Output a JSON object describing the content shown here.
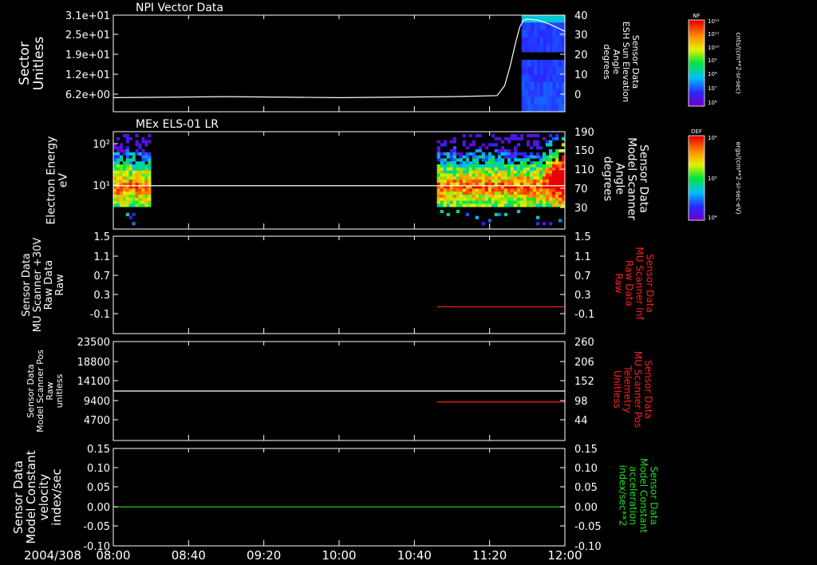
{
  "date_label": "2004/308",
  "time_ticks": [
    "08:00",
    "08:40",
    "09:20",
    "10:00",
    "10:40",
    "11:20",
    "12:00"
  ],
  "colors": {
    "background": "#000000",
    "axis": "#ffffff",
    "red": "#ff2020",
    "green": "#22dd22"
  },
  "colorbars": [
    {
      "id": "nf",
      "title": "NF",
      "ticks": [
        "10¹²",
        "10¹¹",
        "10¹⁰",
        "10⁹",
        "10⁸",
        "10⁷",
        "10⁶"
      ],
      "unit": "cnts/(cm**2-sr-sec)"
    },
    {
      "id": "def",
      "title": "DEF",
      "ticks": [
        "10⁶",
        "10⁵",
        "10⁴"
      ],
      "unit": "ergs/(cm**2-sr-sec-eV)"
    }
  ],
  "chart_data": [
    {
      "type": "heatmap",
      "title": "NPI Vector Data",
      "ylabel": [
        "Sector",
        "Unitless"
      ],
      "y_ticks": [
        "3.1e+01",
        "2.5e+01",
        "1.9e+01",
        "1.2e+01",
        "6.2e+00"
      ],
      "y2_ticks": [
        "40",
        "30",
        "20",
        "10",
        "0"
      ],
      "y2label": [
        "Sensor Data",
        "ESH Sun Elevation",
        "Angle",
        "degrees"
      ],
      "y2lim": [
        -8,
        40
      ],
      "heatmap_span": [
        "11:37",
        "12:00"
      ],
      "line": {
        "name": "ESH Sun Elevation Angle",
        "color": "#ffffff",
        "x": [
          "08:00",
          "09:00",
          "10:00",
          "11:00",
          "11:24",
          "11:28",
          "11:31",
          "11:34",
          "11:36",
          "11:38",
          "11:40",
          "11:46",
          "11:52",
          "12:00"
        ],
        "y": [
          -1,
          -0.5,
          -1,
          -0.5,
          0,
          5,
          15,
          27,
          34,
          37.5,
          38,
          37.5,
          35.5,
          32
        ]
      }
    },
    {
      "type": "heatmap",
      "title": "MEx ELS-01 LR",
      "ylabel": [
        "Electron Energy",
        "eV"
      ],
      "y_ticks": [
        "10²",
        "10¹"
      ],
      "y2_ticks": [
        "190",
        "150",
        "110",
        "70",
        "30"
      ],
      "y2label": [
        "Sensor Data",
        "Model Scanner",
        "Angle",
        "degrees"
      ],
      "y2lim": [
        10,
        190
      ],
      "heatmap_spans": [
        [
          "08:00",
          "08:20"
        ],
        [
          "10:52",
          "12:00"
        ]
      ],
      "line": {
        "name": "Model Scanner Angle",
        "color": "#ffffff",
        "x": [
          "08:00",
          "12:00"
        ],
        "y": [
          90,
          90
        ]
      }
    },
    {
      "type": "line",
      "ylabel": [
        "Sensor Data",
        "MU Scanner +30V",
        "Raw Data",
        "Raw"
      ],
      "y_ticks": [
        "1.5",
        "1.1",
        "0.7",
        "0.3",
        "-0.1"
      ],
      "ylim": [
        -0.5,
        1.5
      ],
      "y2_ticks": [
        "1.5",
        "1.1",
        "0.7",
        "0.3",
        "-0.1"
      ],
      "y2label": [
        "Sensor Data",
        "MU Scanner Inf",
        "Raw Data",
        "Raw"
      ],
      "series": [
        {
          "axis": "right",
          "color": "#ff2020",
          "x": [
            "10:52",
            "12:00"
          ],
          "y": [
            0.05,
            0.05
          ]
        }
      ]
    },
    {
      "type": "line",
      "ylabel": [
        "Sensor Data",
        "Model Scanner Pos",
        "Raw",
        "unitless"
      ],
      "y_ticks": [
        "23500",
        "18800",
        "14100",
        "9400",
        "4700"
      ],
      "ylim": [
        0,
        23500
      ],
      "y2_ticks": [
        "260",
        "206",
        "152",
        "98",
        "44"
      ],
      "y2lim": [
        -10,
        260
      ],
      "y2label": [
        "Sensor Data",
        "MU Scanner Pos",
        "Telemetry",
        "Unitless"
      ],
      "series": [
        {
          "axis": "left",
          "color": "#ffffff",
          "x": [
            "08:00",
            "12:00"
          ],
          "y": [
            11750,
            11750
          ]
        },
        {
          "axis": "right",
          "color": "#ff2020",
          "x": [
            "10:52",
            "12:00"
          ],
          "y": [
            95,
            95
          ]
        }
      ]
    },
    {
      "type": "line",
      "ylabel": [
        "Sensor Data",
        "Model Constant",
        "velocity",
        "index/sec"
      ],
      "y_ticks": [
        "0.15",
        "0.10",
        "0.05",
        "0.00",
        "-0.05",
        "-0.10"
      ],
      "ylim": [
        -0.1,
        0.15
      ],
      "y2_ticks": [
        "0.15",
        "0.10",
        "0.05",
        "0.00",
        "-0.05",
        "-0.10"
      ],
      "y2label": [
        "Sensor Data",
        "Model Constant",
        "acceleration",
        "index/sec**2"
      ],
      "series": [
        {
          "axis": "both",
          "color": "#22dd22",
          "x": [
            "08:00",
            "12:00"
          ],
          "y": [
            0,
            0
          ]
        }
      ]
    }
  ]
}
